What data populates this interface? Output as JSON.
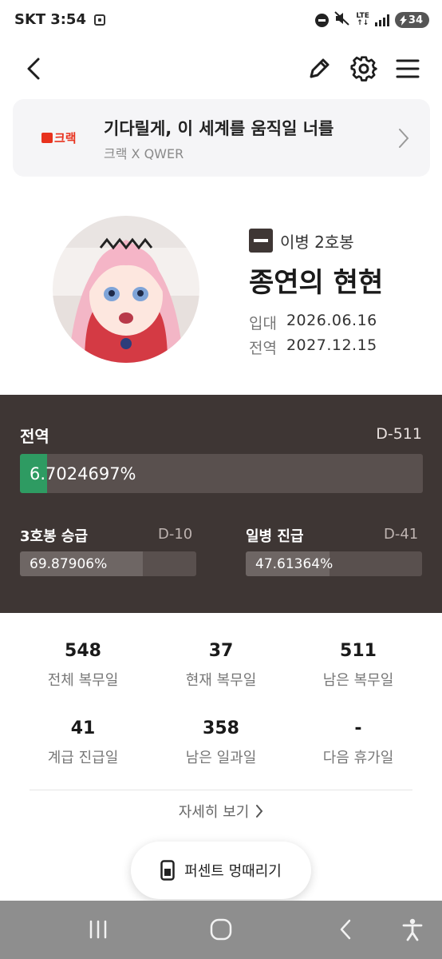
{
  "status_bar": {
    "carrier": "SKT",
    "time": "3:54",
    "network_top": "LTE",
    "network_bottom": "↑↓",
    "battery": "34",
    "icons": [
      "app-notification-icon",
      "do-not-disturb-icon",
      "mute-icon",
      "signal-icon",
      "battery-icon"
    ]
  },
  "top_nav": {
    "icons": [
      "back-icon",
      "pencil-icon",
      "gear-icon",
      "menu-icon"
    ]
  },
  "banner": {
    "logo_text": "크랙",
    "title": "기다릴게, 이 세계를 움직일 너를",
    "subtitle": "크랙 X QWER",
    "brand_color": "#e8321e"
  },
  "profile": {
    "rank": "이병 2호봉",
    "name": "종연의 현현",
    "enlist_label": "입대",
    "enlist_date": "2026.06.16",
    "discharge_label": "전역",
    "discharge_date": "2027.12.15"
  },
  "progress": {
    "main": {
      "label": "전역",
      "dday": "D-511",
      "percent_text": "6.7024697%",
      "fraction": 0.067024697,
      "color": "#2e9b62"
    },
    "promo_a": {
      "label": "3호봉 승급",
      "dday": "D-10",
      "percent_text": "69.87906%",
      "fraction": 0.6987906,
      "color": "#6e6664"
    },
    "promo_b": {
      "label": "일병 진급",
      "dday": "D-41",
      "percent_text": "47.61364%",
      "fraction": 0.4761364,
      "color": "#6e6664"
    }
  },
  "stats": [
    {
      "value": "548",
      "label": "전체 복무일"
    },
    {
      "value": "37",
      "label": "현재 복무일"
    },
    {
      "value": "511",
      "label": "남은 복무일"
    },
    {
      "value": "41",
      "label": "계급 진급일"
    },
    {
      "value": "358",
      "label": "남은 일과일"
    },
    {
      "value": "-",
      "label": "다음 휴가일"
    }
  ],
  "more_link": "자세히 보기",
  "pill_button": "퍼센트 멍때리기",
  "system_nav": {
    "icons": [
      "recent-apps-icon",
      "home-icon",
      "back-nav-icon",
      "accessibility-icon"
    ]
  }
}
